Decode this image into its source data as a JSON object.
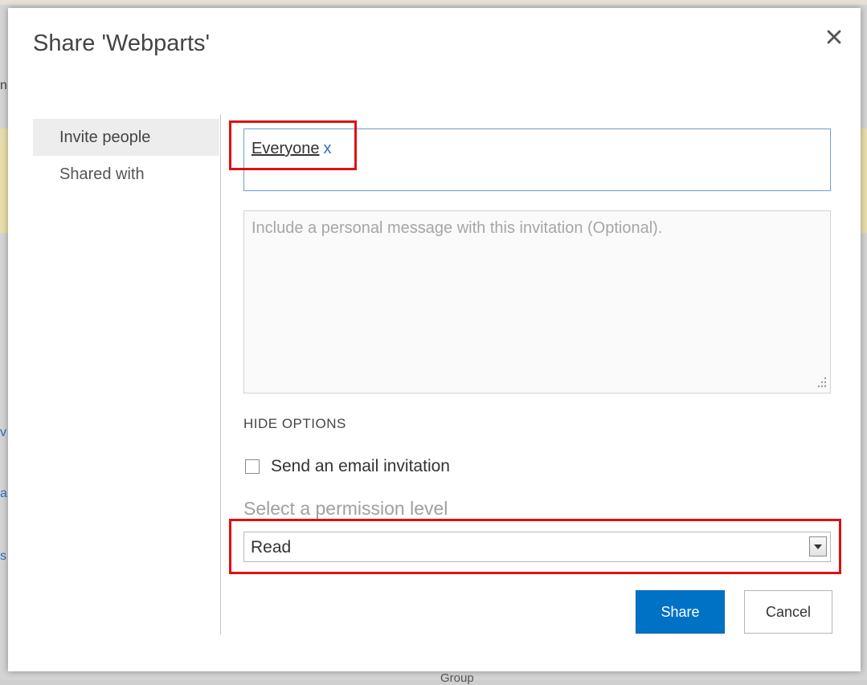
{
  "dialog": {
    "title": "Share 'Webparts'",
    "close_icon": "close-icon"
  },
  "nav": {
    "items": [
      {
        "label": "Invite people",
        "active": true
      },
      {
        "label": "Shared with",
        "active": false
      }
    ]
  },
  "invite": {
    "people": [
      {
        "name": "Everyone",
        "remove_label": "x"
      }
    ],
    "message_placeholder": "Include a personal message with this invitation (Optional).",
    "message_value": "",
    "hide_options_label": "HIDE OPTIONS",
    "email_invitation": {
      "label": "Send an email invitation",
      "checked": false
    },
    "permission": {
      "label": "Select a permission level",
      "selected": "Read"
    }
  },
  "buttons": {
    "share": "Share",
    "cancel": "Cancel"
  },
  "colors": {
    "accent": "#0072c6",
    "highlight": "#e01010",
    "link": "#2a73c3"
  },
  "background": {
    "fragments": [
      "n",
      "v",
      "a",
      "s"
    ],
    "group_label": "Group"
  }
}
